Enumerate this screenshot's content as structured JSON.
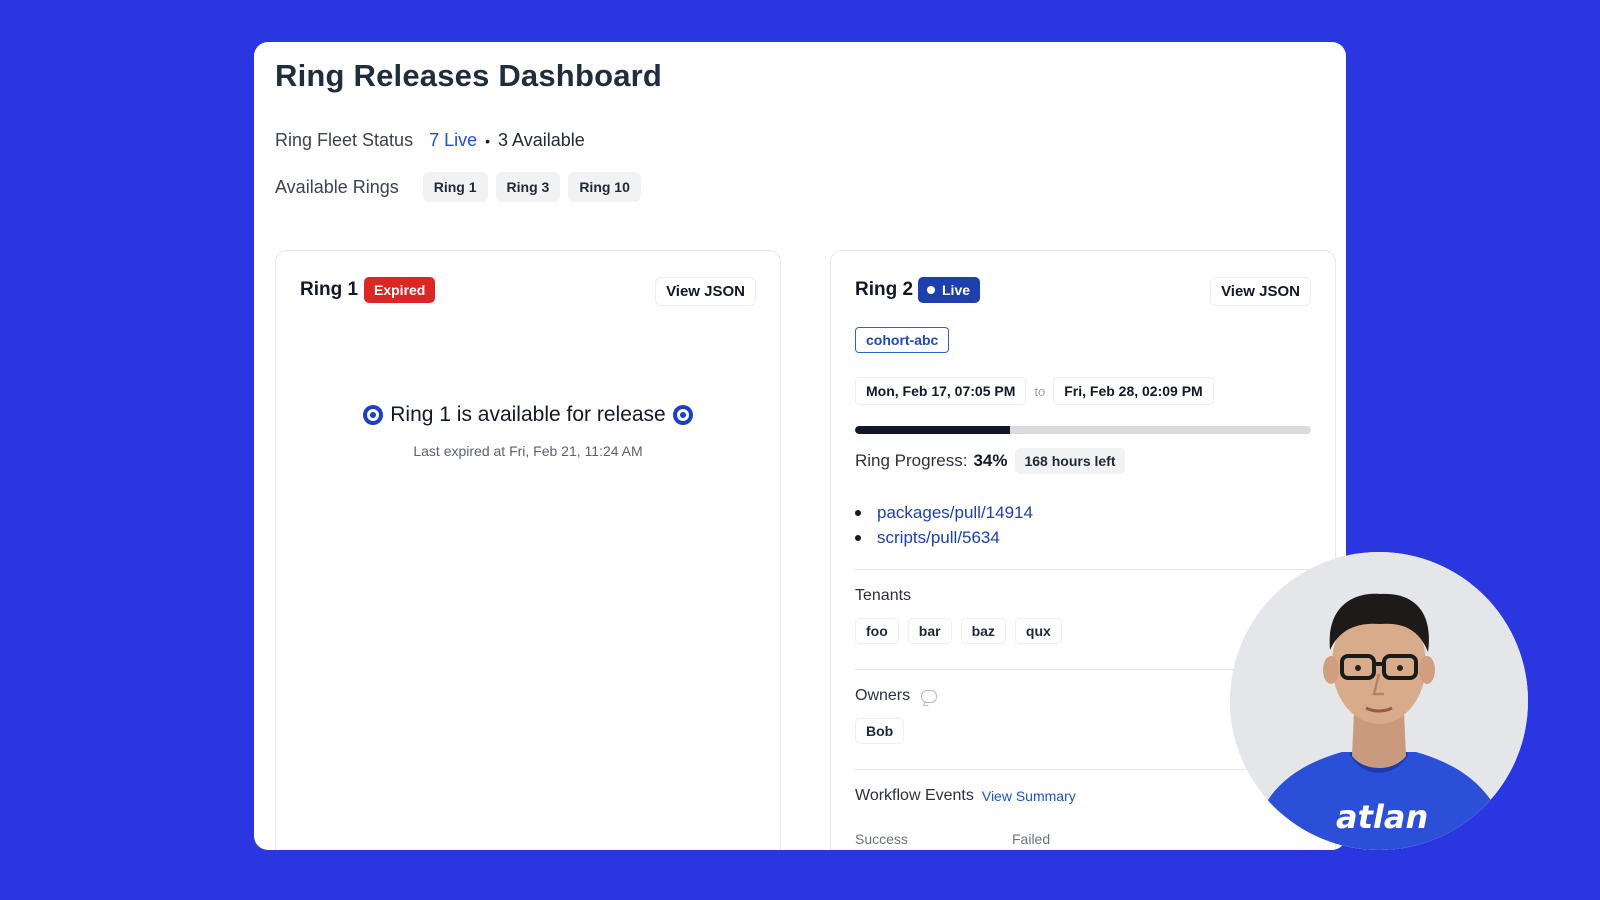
{
  "page": {
    "title": "Ring Releases Dashboard"
  },
  "fleet": {
    "label": "Ring Fleet Status",
    "live": "7 Live",
    "separator": "•",
    "available": "3 Available"
  },
  "available_rings": {
    "label": "Available Rings",
    "chips": [
      "Ring 1",
      "Ring 3",
      "Ring 10"
    ]
  },
  "ring1": {
    "title": "Ring 1",
    "status": "Expired",
    "view_json": "View JSON",
    "available_message": "Ring 1 is available for release",
    "last_expired": "Last expired at Fri, Feb 21, 11:24 AM"
  },
  "ring2": {
    "title": "Ring 2",
    "status": "Live",
    "view_json": "View JSON",
    "cohort": "cohort-abc",
    "start": "Mon, Feb 17, 07:05 PM",
    "to": "to",
    "end": "Fri, Feb 28, 02:09 PM",
    "progress": {
      "label": "Ring Progress:",
      "percent": "34%",
      "value": 0.34,
      "hours_left": "168 hours left"
    },
    "pulls": [
      "packages/pull/14914",
      "scripts/pull/5634"
    ],
    "tenants": {
      "label": "Tenants",
      "items": [
        "foo",
        "bar",
        "baz",
        "qux"
      ]
    },
    "owners": {
      "label": "Owners",
      "items": [
        "Bob"
      ]
    },
    "workflow": {
      "label": "Workflow Events",
      "view_summary": "View Summary",
      "columns": [
        "Success",
        "Failed"
      ]
    }
  },
  "avatar": {
    "shirt_text": "atlan"
  },
  "colors": {
    "background": "#2a36e0",
    "expired": "#dc2626",
    "live": "#1e40af",
    "link": "#1d4ed8"
  }
}
